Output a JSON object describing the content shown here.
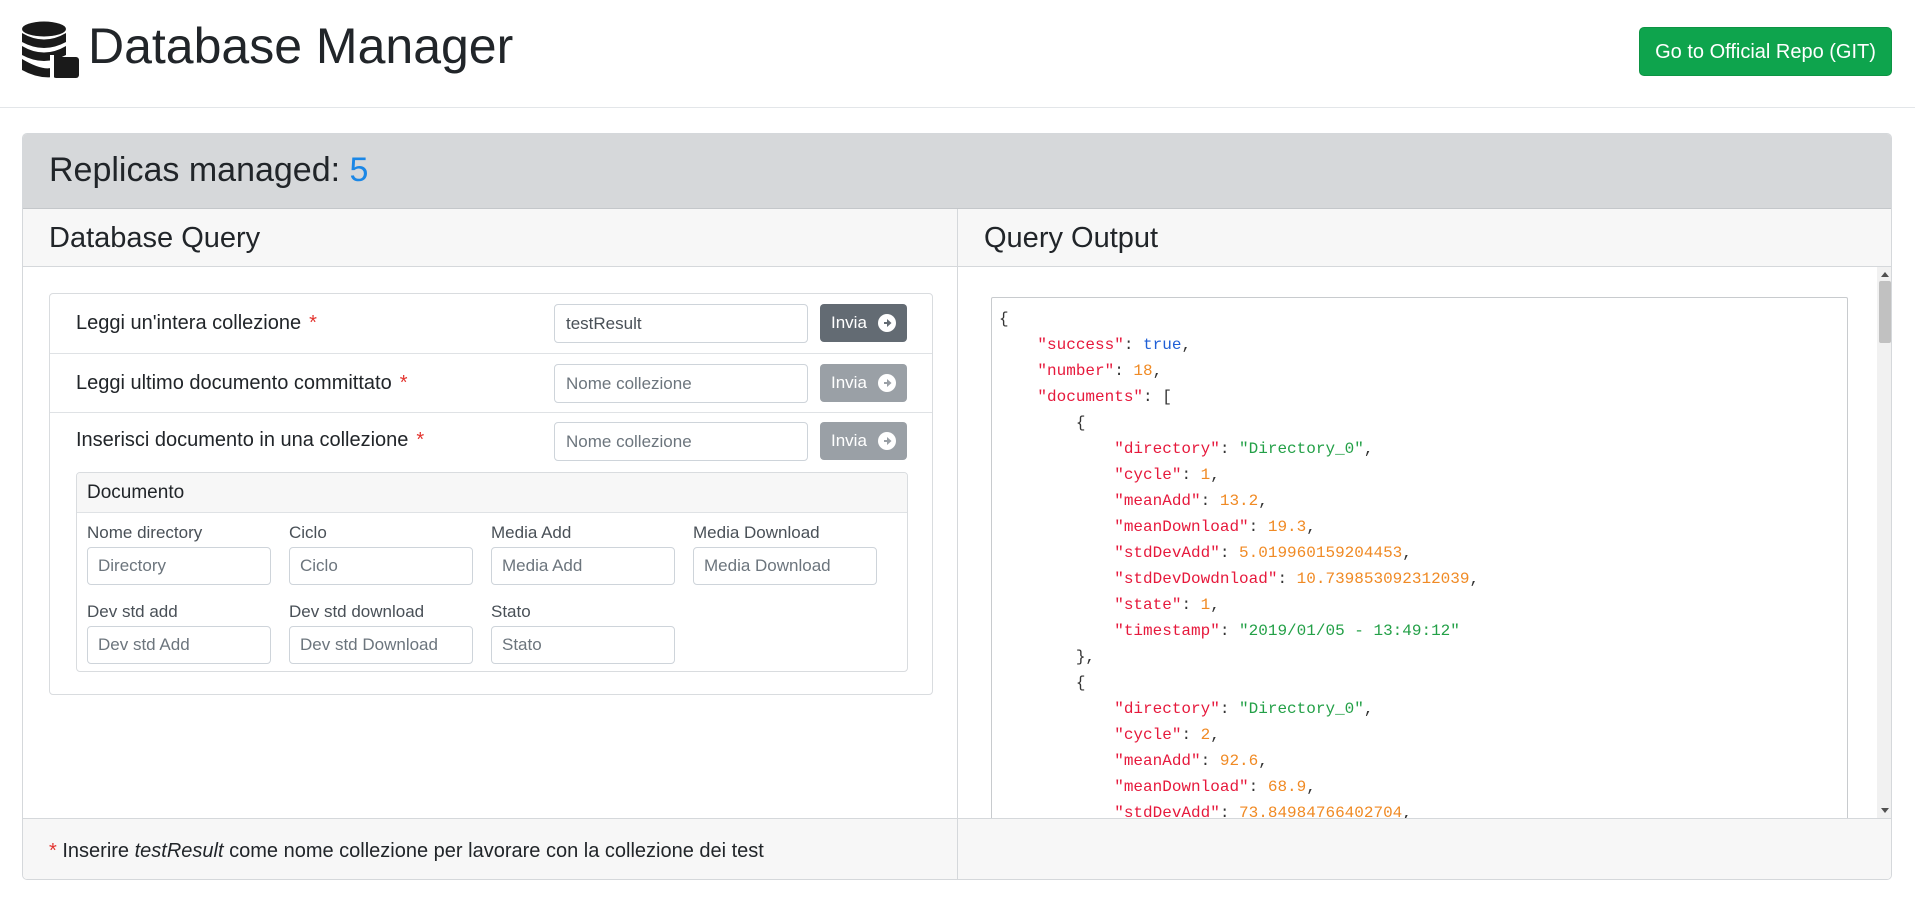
{
  "header": {
    "title": "Database Manager",
    "logo_icon": "database-icon",
    "repo_button": "Go to Official Repo (GIT)"
  },
  "card": {
    "replicas_label": "Replicas managed:",
    "replicas_count": "5"
  },
  "query_panel": {
    "title": "Database Query",
    "required_mark": "*",
    "rows": [
      {
        "label": "Leggi un'intera collezione",
        "input_value": "testResult",
        "input_placeholder": "Nome collezione",
        "button": "Invia",
        "button_state": "active"
      },
      {
        "label": "Leggi ultimo documento committato",
        "input_value": "",
        "input_placeholder": "Nome collezione",
        "button": "Invia",
        "button_state": "disabled"
      },
      {
        "label": "Inserisci documento in una collezione",
        "input_value": "",
        "input_placeholder": "Nome collezione",
        "button": "Invia",
        "button_state": "disabled"
      }
    ],
    "document": {
      "title": "Documento",
      "fields": [
        {
          "label": "Nome directory",
          "placeholder": "Directory"
        },
        {
          "label": "Ciclo",
          "placeholder": "Ciclo"
        },
        {
          "label": "Media Add",
          "placeholder": "Media Add"
        },
        {
          "label": "Media Download",
          "placeholder": "Media Download"
        },
        {
          "label": "Dev std add",
          "placeholder": "Dev std Add"
        },
        {
          "label": "Dev std download",
          "placeholder": "Dev std Download"
        },
        {
          "label": "Stato",
          "placeholder": "Stato"
        }
      ]
    },
    "footer": {
      "before": "Inserire",
      "emphasis": "testResult",
      "after": "come nome collezione per lavorare con la collezione dei test"
    }
  },
  "output_panel": {
    "title": "Query Output",
    "json_lines": [
      [
        [
          "p",
          "{"
        ]
      ],
      [
        [
          "p",
          "    "
        ],
        [
          "k",
          "\"success\""
        ],
        [
          "p",
          ": "
        ],
        [
          "b",
          "true"
        ],
        [
          "p",
          ","
        ]
      ],
      [
        [
          "p",
          "    "
        ],
        [
          "k",
          "\"number\""
        ],
        [
          "p",
          ": "
        ],
        [
          "n",
          "18"
        ],
        [
          "p",
          ","
        ]
      ],
      [
        [
          "p",
          "    "
        ],
        [
          "k",
          "\"documents\""
        ],
        [
          "p",
          ": ["
        ]
      ],
      [
        [
          "p",
          "        {"
        ]
      ],
      [
        [
          "p",
          "            "
        ],
        [
          "k",
          "\"directory\""
        ],
        [
          "p",
          ": "
        ],
        [
          "s",
          "\"Directory_0\""
        ],
        [
          "p",
          ","
        ]
      ],
      [
        [
          "p",
          "            "
        ],
        [
          "k",
          "\"cycle\""
        ],
        [
          "p",
          ": "
        ],
        [
          "n",
          "1"
        ],
        [
          "p",
          ","
        ]
      ],
      [
        [
          "p",
          "            "
        ],
        [
          "k",
          "\"meanAdd\""
        ],
        [
          "p",
          ": "
        ],
        [
          "n",
          "13.2"
        ],
        [
          "p",
          ","
        ]
      ],
      [
        [
          "p",
          "            "
        ],
        [
          "k",
          "\"meanDownload\""
        ],
        [
          "p",
          ": "
        ],
        [
          "n",
          "19.3"
        ],
        [
          "p",
          ","
        ]
      ],
      [
        [
          "p",
          "            "
        ],
        [
          "k",
          "\"stdDevAdd\""
        ],
        [
          "p",
          ": "
        ],
        [
          "n",
          "5.019960159204453"
        ],
        [
          "p",
          ","
        ]
      ],
      [
        [
          "p",
          "            "
        ],
        [
          "k",
          "\"stdDevDowdnload\""
        ],
        [
          "p",
          ": "
        ],
        [
          "n",
          "10.739853092312039"
        ],
        [
          "p",
          ","
        ]
      ],
      [
        [
          "p",
          "            "
        ],
        [
          "k",
          "\"state\""
        ],
        [
          "p",
          ": "
        ],
        [
          "n",
          "1"
        ],
        [
          "p",
          ","
        ]
      ],
      [
        [
          "p",
          "            "
        ],
        [
          "k",
          "\"timestamp\""
        ],
        [
          "p",
          ": "
        ],
        [
          "s",
          "\"2019/01/05 - 13:49:12\""
        ]
      ],
      [
        [
          "p",
          "        },"
        ]
      ],
      [
        [
          "p",
          "        {"
        ]
      ],
      [
        [
          "p",
          "            "
        ],
        [
          "k",
          "\"directory\""
        ],
        [
          "p",
          ": "
        ],
        [
          "s",
          "\"Directory_0\""
        ],
        [
          "p",
          ","
        ]
      ],
      [
        [
          "p",
          "            "
        ],
        [
          "k",
          "\"cycle\""
        ],
        [
          "p",
          ": "
        ],
        [
          "n",
          "2"
        ],
        [
          "p",
          ","
        ]
      ],
      [
        [
          "p",
          "            "
        ],
        [
          "k",
          "\"meanAdd\""
        ],
        [
          "p",
          ": "
        ],
        [
          "n",
          "92.6"
        ],
        [
          "p",
          ","
        ]
      ],
      [
        [
          "p",
          "            "
        ],
        [
          "k",
          "\"meanDownload\""
        ],
        [
          "p",
          ": "
        ],
        [
          "n",
          "68.9"
        ],
        [
          "p",
          ","
        ]
      ],
      [
        [
          "p",
          "            "
        ],
        [
          "k",
          "\"stdDevAdd\""
        ],
        [
          "p",
          ": "
        ],
        [
          "n",
          "73.84984766402704"
        ],
        [
          "p",
          ","
        ]
      ]
    ],
    "colors": {
      "key": "#e6193c",
      "string": "#23a047",
      "number": "#f08a24",
      "boolean": "#1f5fd6"
    }
  },
  "colors": {
    "accent_green": "#0ea44d",
    "replicas_count": "#1b87e6",
    "required": "#e3342f",
    "button_active": "#636b73",
    "button_disabled": "#9aa0a6"
  }
}
